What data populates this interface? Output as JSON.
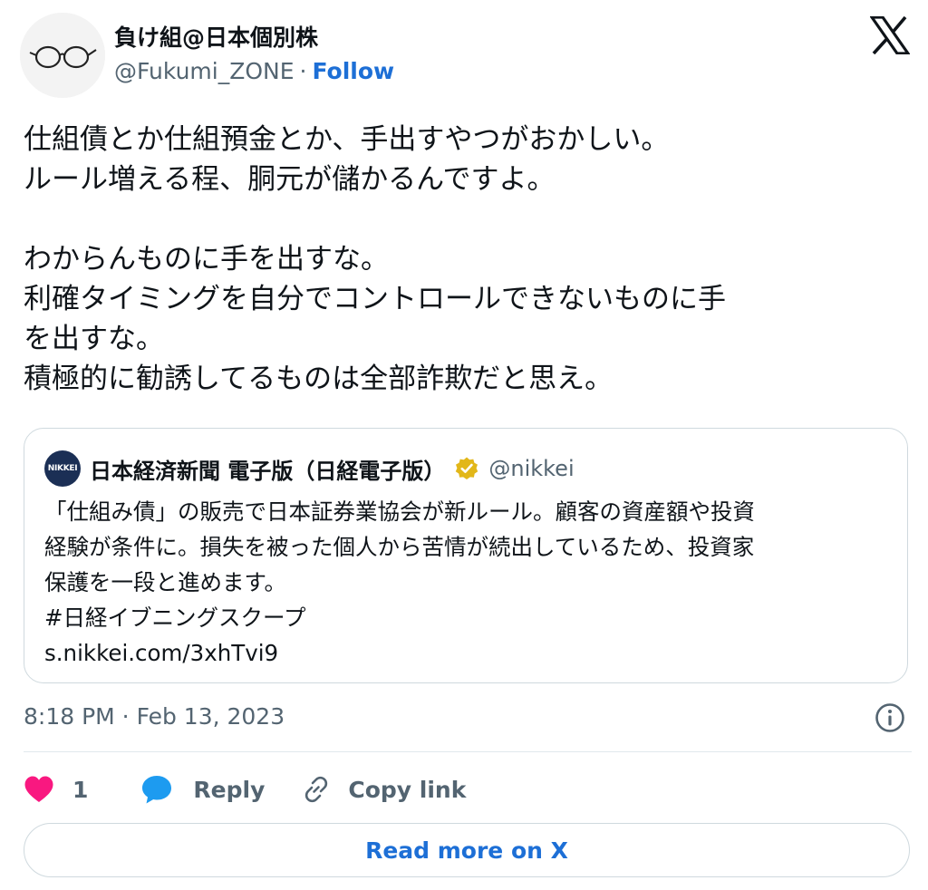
{
  "author": {
    "display_name": "負け組@日本個別株",
    "handle": "@Fukumi_ZONE",
    "separator": "·",
    "follow_label": "Follow"
  },
  "tweet": {
    "lines": [
      "仕組債とか仕組預金とか、手出すやつがおかしい。",
      "ルール増える程、胴元が儲かるんですよ。",
      "",
      "わからんものに手を出すな。",
      "利確タイミングを自分でコントロールできないものに手",
      "を出すな。",
      "積極的に勧誘してるものは全部詐欺だと思え。"
    ]
  },
  "quote": {
    "avatar_text": "NIKKEI",
    "name": "日本経済新聞 電子版（日経電子版）",
    "handle": "@nikkei",
    "lines": [
      "「仕組み債」の販売で日本証券業協会が新ルール。顧客の資産額や投資",
      "経験が条件に。損失を被った個人から苦情が続出しているため、投資家",
      "保護を一段と進めます。",
      "#日経イブニングスクープ",
      "s.nikkei.com/3xhTvi9"
    ]
  },
  "timestamp": "8:18 PM · Feb 13, 2023",
  "actions": {
    "like_count": "1",
    "reply_label": "Reply",
    "copy_link_label": "Copy link"
  },
  "read_more_label": "Read more on X",
  "colors": {
    "text": "#0f1419",
    "muted": "#536471",
    "link": "#1d6fd6",
    "like": "#f91880",
    "reply": "#1d9bf0",
    "border": "#cfd9de",
    "verified": "#e2b719"
  },
  "icons": {
    "avatar": "glasses-avatar-icon",
    "brand": "x-logo-icon",
    "verified": "verified-badge-icon",
    "info": "info-icon",
    "like": "heart-icon",
    "reply": "speech-bubble-icon",
    "copy_link": "link-icon"
  }
}
